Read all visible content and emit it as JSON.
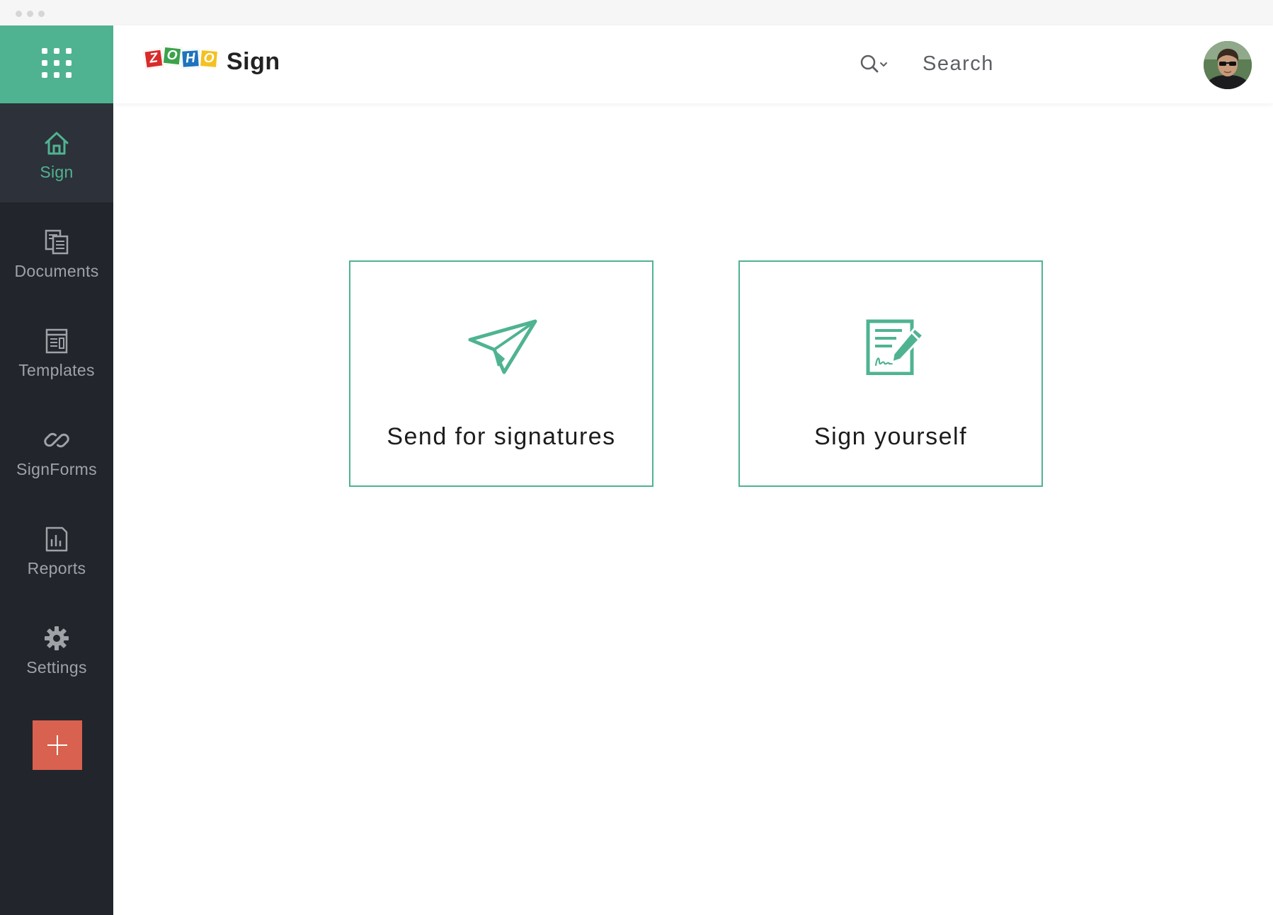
{
  "app": {
    "brand_letters": [
      "Z",
      "O",
      "H",
      "O"
    ],
    "brand_word": "Sign",
    "accent_color": "#4fb391",
    "sidebar_color": "#22252b",
    "create_color": "#d9614f"
  },
  "header": {
    "search_label": "Search"
  },
  "sidebar": {
    "items": [
      {
        "label": "Sign",
        "icon": "home-icon",
        "active": true
      },
      {
        "label": "Documents",
        "icon": "documents-icon",
        "active": false
      },
      {
        "label": "Templates",
        "icon": "templates-icon",
        "active": false
      },
      {
        "label": "SignForms",
        "icon": "link-icon",
        "active": false
      },
      {
        "label": "Reports",
        "icon": "reports-icon",
        "active": false
      },
      {
        "label": "Settings",
        "icon": "gear-icon",
        "active": false
      }
    ],
    "create_icon": "plus-icon"
  },
  "main": {
    "actions": [
      {
        "label": "Send for signatures",
        "icon": "paper-plane-icon"
      },
      {
        "label": "Sign yourself",
        "icon": "sign-document-icon"
      }
    ]
  }
}
